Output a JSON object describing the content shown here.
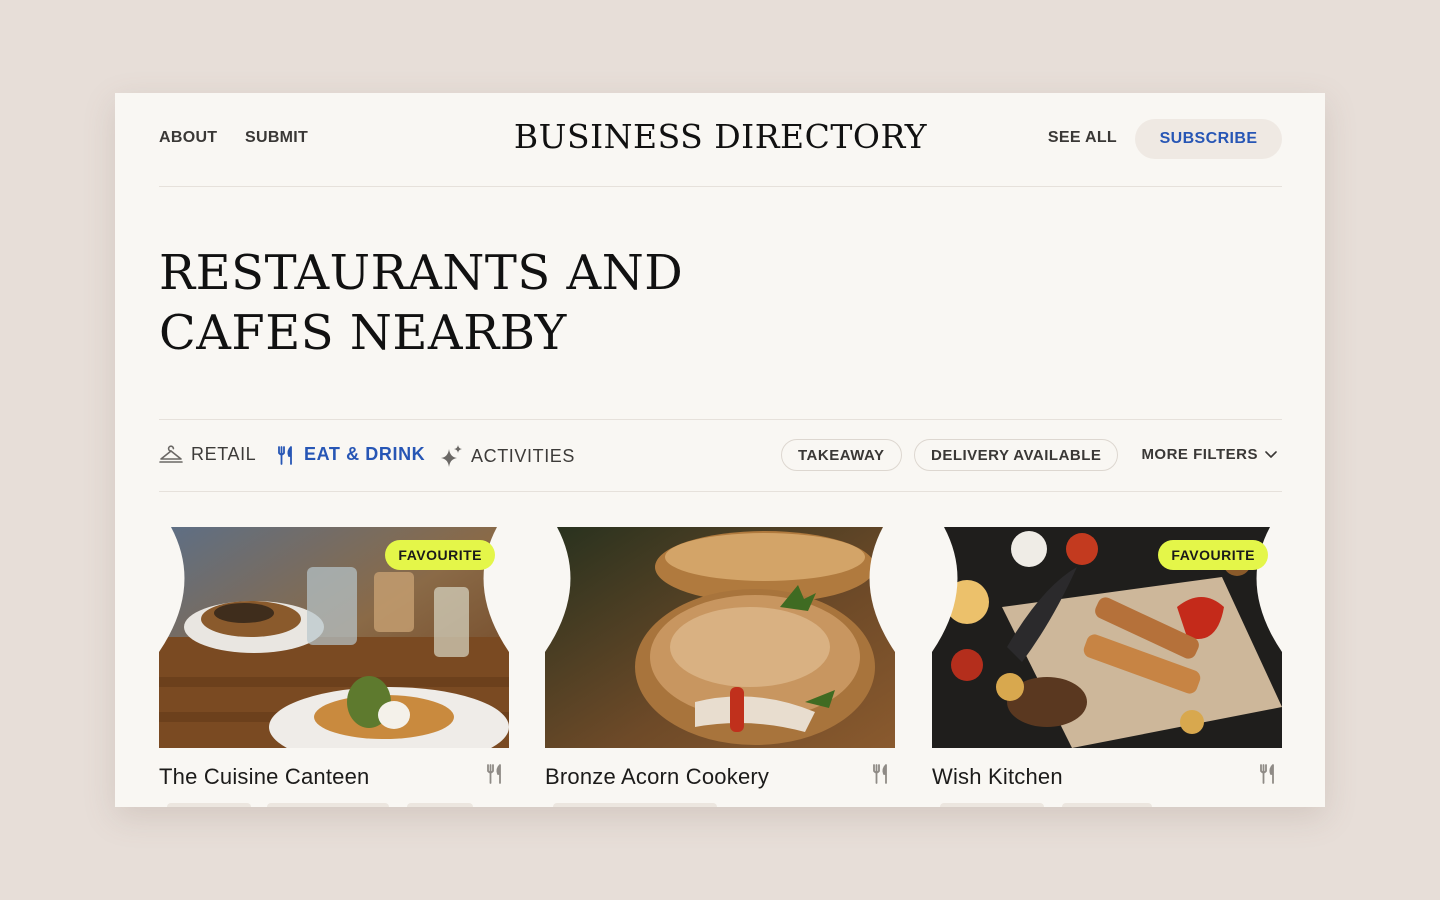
{
  "nav": {
    "about": "ABOUT",
    "submit": "SUBMIT",
    "brand": "BUSINESS DIRECTORY",
    "see_all": "SEE ALL",
    "subscribe": "SUBSCRIBE"
  },
  "page": {
    "title": "RESTAURANTS AND CAFES NEARBY"
  },
  "categories": [
    {
      "label": "RETAIL",
      "icon": "hanger-icon",
      "active": false
    },
    {
      "label": "EAT & DRINK",
      "icon": "fork-knife-icon",
      "active": true
    },
    {
      "label": "ACTIVITIES",
      "icon": "sparkle-icon",
      "active": false
    }
  ],
  "filters": {
    "chips": [
      "TAKEAWAY",
      "DELIVERY AVAILABLE"
    ],
    "more": "MORE FILTERS"
  },
  "listings": [
    {
      "name": "The Cuisine Canteen",
      "badge": "FAVOURITE",
      "icon": "fork-knife-icon"
    },
    {
      "name": "Bronze Acorn Cookery",
      "badge": "",
      "icon": "fork-knife-icon"
    },
    {
      "name": "Wish Kitchen",
      "badge": "FAVOURITE",
      "icon": "fork-knife-icon"
    }
  ],
  "colors": {
    "background": "#e7ded8",
    "card": "#f9f7f3",
    "accent": "#2756b5",
    "badge": "#e4f649"
  }
}
